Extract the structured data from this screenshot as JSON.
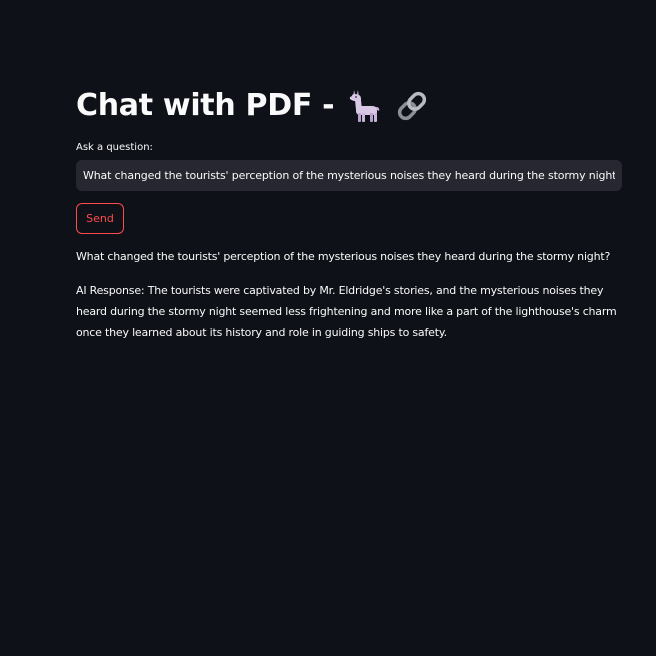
{
  "header": {
    "title": "Chat with PDF - ",
    "icons": [
      "llama-icon",
      "link-icon"
    ]
  },
  "question_field": {
    "label": "Ask a question:",
    "value": "What changed the tourists' perception of the mysterious noises they heard during the stormy night?"
  },
  "send_button": {
    "label": "Send"
  },
  "conversation": {
    "question": "What changed the tourists' perception of the mysterious noises they heard during the stormy night?",
    "response": "AI Response: The tourists were captivated by Mr. Eldridge's stories, and the mysterious noises they heard during the stormy night seemed less frightening and more like a part of the lighthouse's charm once they learned about its history and role in guiding ships to safety."
  },
  "colors": {
    "background": "#0e1117",
    "input_background": "#262730",
    "accent": "#ff4b4b",
    "text": "#fafafa"
  }
}
